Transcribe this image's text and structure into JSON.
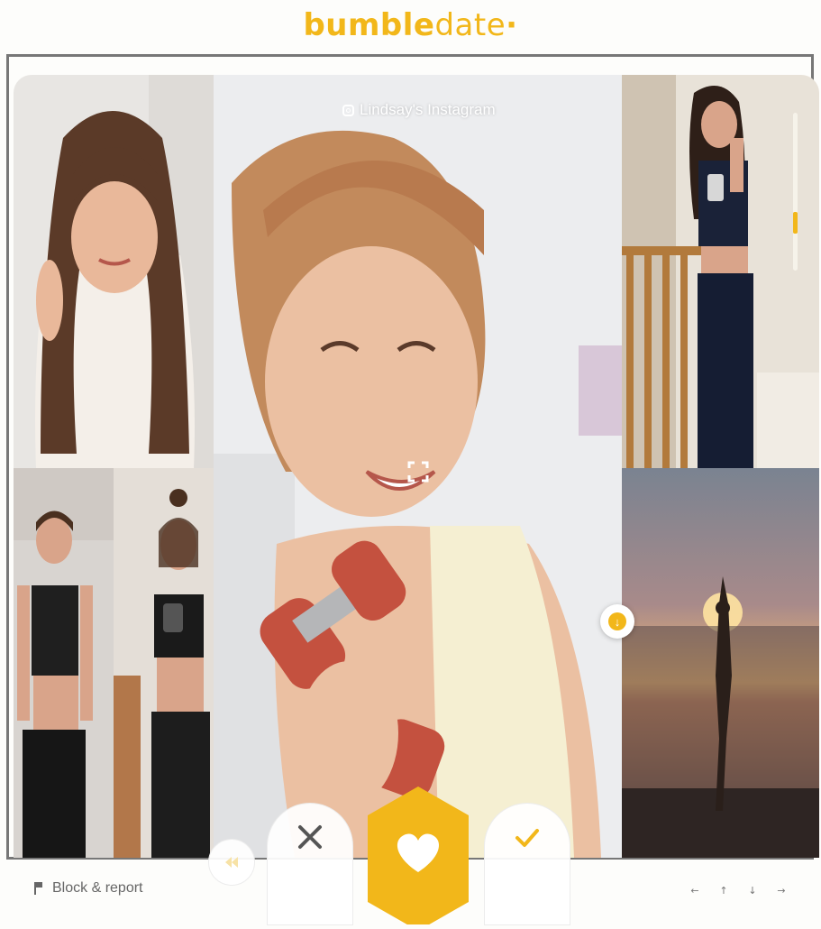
{
  "brand": {
    "logo_text_bold": "bumble",
    "logo_text_thin": "date",
    "logo_suffix": "·",
    "accent_color": "#f2b71a"
  },
  "profile": {
    "instagram_label": "Lindsay's Instagram",
    "photos": [
      {
        "id": "photo-1",
        "subject": "woman-holding-hair-sweater"
      },
      {
        "id": "photo-2",
        "subject": "woman-crop-top-standing"
      },
      {
        "id": "photo-3",
        "subject": "woman-mirror-selfie"
      },
      {
        "id": "photo-main",
        "subject": "woman-smiling-dumbbells"
      },
      {
        "id": "photo-4",
        "subject": "woman-mirror-selfie-stairs"
      },
      {
        "id": "photo-5",
        "subject": "silhouette-sunset-beach"
      }
    ]
  },
  "actions": {
    "undo_icon": "undo-icon",
    "pass_icon": "x-icon",
    "like_icon": "heart-icon",
    "superswipe_icon": "check-icon",
    "expand_icon": "expand-icon",
    "scroll_down_icon": "arrow-down-icon"
  },
  "footer": {
    "block_report_label": "Block & report",
    "keyboard_hints": [
      "←",
      "↑",
      "↓",
      "→"
    ]
  }
}
